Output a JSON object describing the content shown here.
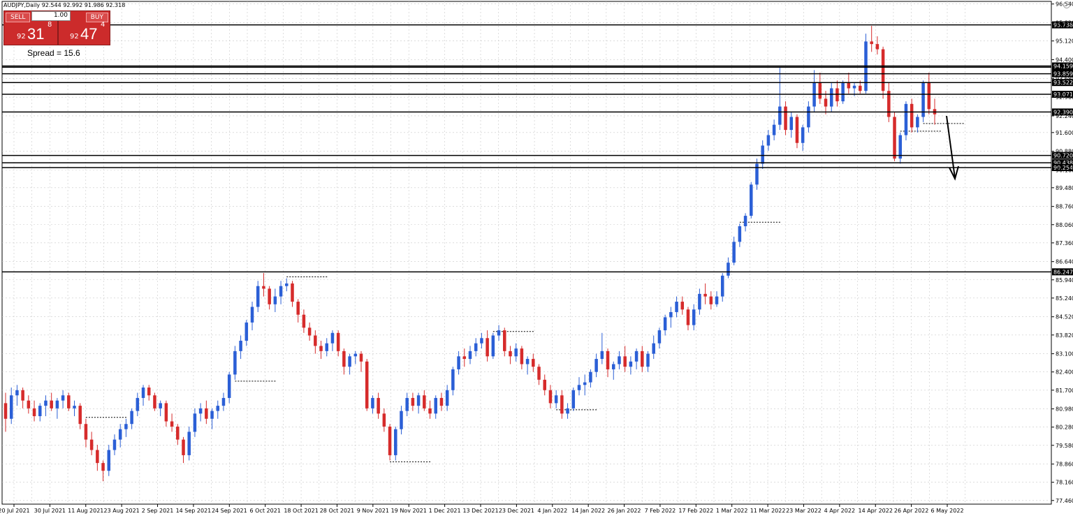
{
  "header": {
    "symbol_line": "AUDJPY,Daily  92.544 92.992 91.986 92.318"
  },
  "trade_panel": {
    "sell_label": "SELL",
    "buy_label": "BUY",
    "quantity": "1.00",
    "sell_price": {
      "prefix": "92",
      "big": "31",
      "sup": "8"
    },
    "buy_price": {
      "prefix": "92",
      "big": "47",
      "sup": "4"
    },
    "spread_text": "Spread = 15.6"
  },
  "colors": {
    "bull": "#2b5fd6",
    "bear": "#d62b2b",
    "grid": "#c8c8c8",
    "level": "#000000"
  },
  "chart_data": {
    "type": "candlestick",
    "symbol": "AUDJPY",
    "timeframe": "Daily",
    "ylim": [
      77.32,
      96.64
    ],
    "y_ticks": [
      "96.540",
      "95.820",
      "95.120",
      "94.400",
      "93.680",
      "92.960",
      "92.240",
      "91.600",
      "90.880",
      "90.160",
      "89.480",
      "88.760",
      "88.060",
      "87.360",
      "86.640",
      "85.940",
      "85.240",
      "84.520",
      "83.820",
      "83.100",
      "82.400",
      "81.700",
      "80.980",
      "80.280",
      "79.580",
      "78.860",
      "78.160",
      "77.460"
    ],
    "x_ticks": [
      "20 Jul 2021",
      "30 Jul 2021",
      "11 Aug 2021",
      "23 Aug 2021",
      "2 Sep 2021",
      "14 Sep 2021",
      "24 Sep 2021",
      "6 Oct 2021",
      "18 Oct 2021",
      "28 Oct 2021",
      "9 Nov 2021",
      "19 Nov 2021",
      "1 Dec 2021",
      "13 Dec 2021",
      "23 Dec 2021",
      "4 Jan 2022",
      "14 Jan 2022",
      "26 Jan 2022",
      "7 Feb 2022",
      "17 Feb 2022",
      "1 Mar 2022",
      "11 Mar 2022",
      "23 Mar 2022",
      "4 Apr 2022",
      "14 Apr 2022",
      "26 Apr 2022",
      "6 May 2022"
    ],
    "levels": [
      {
        "value": 95.738,
        "label": "95.738"
      },
      {
        "value": 94.111,
        "label": "94.111"
      },
      {
        "value": 94.159,
        "label": "94.159"
      },
      {
        "value": 93.859,
        "label": "93.859"
      },
      {
        "value": 93.522,
        "label": "93.522"
      },
      {
        "value": 93.071,
        "label": "93.071"
      },
      {
        "value": 92.39,
        "label": "92.390"
      },
      {
        "value": 90.72,
        "label": "90.720"
      },
      {
        "value": 90.438,
        "label": "90.438"
      },
      {
        "value": 90.254,
        "label": "90.254"
      },
      {
        "value": 86.247,
        "label": "86.247"
      }
    ],
    "candles": [
      [
        81.2,
        81.6,
        80.1,
        80.6
      ],
      [
        80.6,
        81.8,
        80.4,
        81.5
      ],
      [
        81.5,
        81.9,
        81.1,
        81.7
      ],
      [
        81.7,
        81.8,
        81.0,
        81.3
      ],
      [
        81.3,
        81.5,
        80.8,
        81.0
      ],
      [
        81.0,
        81.3,
        80.5,
        80.7
      ],
      [
        80.7,
        81.2,
        80.5,
        81.1
      ],
      [
        81.1,
        81.5,
        80.7,
        81.3
      ],
      [
        81.3,
        81.6,
        80.9,
        81.0
      ],
      [
        81.0,
        81.4,
        80.6,
        81.3
      ],
      [
        81.3,
        81.7,
        81.0,
        81.5
      ],
      [
        81.5,
        81.6,
        80.9,
        81.0
      ],
      [
        81.0,
        81.3,
        80.7,
        81.1
      ],
      [
        81.1,
        81.2,
        80.2,
        80.4
      ],
      [
        80.4,
        80.6,
        79.5,
        79.8
      ],
      [
        79.8,
        80.1,
        79.2,
        79.4
      ],
      [
        79.4,
        79.6,
        78.6,
        78.9
      ],
      [
        78.9,
        79.0,
        78.2,
        78.6
      ],
      [
        78.6,
        79.6,
        78.4,
        79.4
      ],
      [
        79.4,
        80.0,
        79.2,
        79.8
      ],
      [
        79.8,
        80.4,
        79.5,
        80.2
      ],
      [
        80.2,
        80.6,
        79.9,
        80.4
      ],
      [
        80.4,
        81.0,
        80.2,
        80.9
      ],
      [
        80.9,
        81.6,
        80.7,
        81.4
      ],
      [
        81.4,
        81.9,
        81.1,
        81.8
      ],
      [
        81.8,
        81.9,
        81.3,
        81.5
      ],
      [
        81.5,
        81.6,
        80.9,
        81.0
      ],
      [
        81.0,
        81.3,
        80.7,
        81.2
      ],
      [
        81.2,
        81.3,
        80.3,
        80.5
      ],
      [
        80.5,
        80.8,
        80.1,
        80.3
      ],
      [
        80.3,
        80.4,
        79.6,
        79.8
      ],
      [
        79.8,
        79.9,
        78.9,
        79.2
      ],
      [
        79.2,
        80.3,
        79.0,
        80.1
      ],
      [
        80.1,
        81.0,
        79.9,
        80.8
      ],
      [
        80.8,
        81.2,
        80.5,
        81.0
      ],
      [
        81.0,
        81.3,
        80.4,
        80.6
      ],
      [
        80.6,
        81.0,
        80.2,
        80.9
      ],
      [
        80.9,
        81.3,
        80.6,
        81.1
      ],
      [
        81.1,
        81.6,
        80.9,
        81.4
      ],
      [
        81.4,
        82.4,
        81.2,
        82.3
      ],
      [
        82.3,
        83.4,
        82.1,
        83.2
      ],
      [
        83.2,
        83.8,
        82.9,
        83.6
      ],
      [
        83.6,
        84.4,
        83.4,
        84.3
      ],
      [
        84.3,
        85.1,
        84.0,
        84.9
      ],
      [
        84.9,
        85.9,
        84.7,
        85.7
      ],
      [
        85.7,
        86.2,
        85.3,
        85.6
      ],
      [
        85.6,
        85.7,
        84.8,
        85.0
      ],
      [
        85.0,
        85.6,
        84.7,
        85.3
      ],
      [
        85.3,
        85.9,
        85.0,
        85.7
      ],
      [
        85.7,
        86.0,
        85.5,
        85.8
      ],
      [
        85.8,
        85.9,
        84.9,
        85.1
      ],
      [
        85.1,
        85.2,
        84.3,
        84.6
      ],
      [
        84.6,
        84.8,
        83.9,
        84.1
      ],
      [
        84.1,
        84.3,
        83.6,
        83.8
      ],
      [
        83.8,
        84.0,
        83.1,
        83.4
      ],
      [
        83.4,
        83.6,
        82.9,
        83.2
      ],
      [
        83.2,
        83.7,
        83.0,
        83.5
      ],
      [
        83.5,
        84.0,
        83.2,
        83.9
      ],
      [
        83.9,
        84.0,
        83.0,
        83.2
      ],
      [
        83.2,
        83.3,
        82.3,
        82.6
      ],
      [
        82.6,
        83.1,
        82.3,
        83.0
      ],
      [
        83.0,
        83.2,
        82.7,
        83.1
      ],
      [
        83.1,
        83.2,
        82.4,
        82.8
      ],
      [
        82.8,
        82.9,
        80.9,
        81.0
      ],
      [
        81.0,
        81.5,
        80.8,
        81.4
      ],
      [
        81.4,
        81.6,
        80.6,
        80.8
      ],
      [
        80.8,
        81.0,
        80.1,
        80.3
      ],
      [
        80.3,
        80.4,
        79.0,
        79.2
      ],
      [
        79.2,
        80.3,
        79.0,
        80.2
      ],
      [
        80.2,
        81.1,
        80.0,
        80.9
      ],
      [
        80.9,
        81.6,
        80.7,
        81.4
      ],
      [
        81.4,
        81.6,
        80.9,
        81.1
      ],
      [
        81.1,
        81.6,
        80.8,
        81.5
      ],
      [
        81.5,
        81.7,
        80.9,
        81.0
      ],
      [
        81.0,
        81.3,
        80.6,
        80.8
      ],
      [
        80.8,
        81.5,
        80.6,
        81.4
      ],
      [
        81.4,
        81.6,
        80.9,
        81.1
      ],
      [
        81.1,
        81.9,
        80.9,
        81.7
      ],
      [
        81.7,
        82.6,
        81.5,
        82.5
      ],
      [
        82.5,
        83.2,
        82.3,
        83.0
      ],
      [
        83.0,
        83.3,
        82.6,
        82.9
      ],
      [
        82.9,
        83.4,
        82.7,
        83.2
      ],
      [
        83.2,
        83.7,
        83.0,
        83.5
      ],
      [
        83.5,
        83.9,
        83.3,
        83.7
      ],
      [
        83.7,
        84.0,
        82.8,
        83.0
      ],
      [
        83.0,
        83.9,
        82.9,
        83.8
      ],
      [
        83.8,
        84.2,
        83.6,
        84.0
      ],
      [
        84.0,
        84.1,
        83.0,
        83.2
      ],
      [
        83.2,
        83.4,
        82.7,
        83.0
      ],
      [
        83.0,
        83.5,
        82.8,
        83.3
      ],
      [
        83.3,
        83.4,
        82.5,
        82.7
      ],
      [
        82.7,
        83.0,
        82.3,
        82.9
      ],
      [
        82.9,
        83.1,
        82.4,
        82.6
      ],
      [
        82.6,
        82.7,
        81.9,
        82.1
      ],
      [
        82.1,
        82.3,
        81.5,
        81.7
      ],
      [
        81.7,
        81.9,
        81.0,
        81.2
      ],
      [
        81.2,
        81.7,
        81.0,
        81.5
      ],
      [
        81.5,
        81.7,
        80.6,
        80.8
      ],
      [
        80.8,
        81.2,
        80.6,
        81.0
      ],
      [
        81.0,
        81.8,
        80.9,
        81.7
      ],
      [
        81.7,
        82.2,
        81.5,
        81.9
      ],
      [
        81.9,
        82.3,
        81.5,
        82.0
      ],
      [
        82.0,
        82.5,
        81.8,
        82.4
      ],
      [
        82.4,
        83.1,
        82.2,
        82.9
      ],
      [
        82.9,
        83.9,
        82.7,
        83.2
      ],
      [
        83.2,
        83.3,
        82.2,
        82.5
      ],
      [
        82.5,
        82.8,
        82.1,
        82.7
      ],
      [
        82.7,
        83.2,
        82.5,
        83.0
      ],
      [
        83.0,
        83.4,
        82.4,
        82.6
      ],
      [
        82.6,
        83.0,
        82.3,
        82.8
      ],
      [
        82.8,
        83.3,
        82.5,
        83.2
      ],
      [
        83.2,
        83.4,
        82.4,
        82.6
      ],
      [
        82.6,
        83.2,
        82.4,
        83.1
      ],
      [
        83.1,
        83.8,
        82.9,
        83.5
      ],
      [
        83.5,
        84.1,
        83.3,
        84.0
      ],
      [
        84.0,
        84.6,
        83.8,
        84.5
      ],
      [
        84.5,
        84.9,
        84.1,
        84.7
      ],
      [
        84.7,
        85.3,
        84.5,
        85.1
      ],
      [
        85.1,
        85.3,
        84.6,
        84.8
      ],
      [
        84.8,
        84.9,
        84.0,
        84.2
      ],
      [
        84.2,
        85.0,
        84.0,
        84.8
      ],
      [
        84.8,
        85.6,
        84.6,
        85.4
      ],
      [
        85.4,
        85.8,
        85.0,
        85.3
      ],
      [
        85.3,
        85.5,
        84.8,
        85.0
      ],
      [
        85.0,
        85.5,
        84.9,
        85.3
      ],
      [
        85.3,
        86.2,
        85.1,
        86.1
      ],
      [
        86.1,
        86.8,
        86.0,
        86.6
      ],
      [
        86.6,
        87.6,
        86.5,
        87.4
      ],
      [
        87.4,
        88.1,
        87.2,
        88.0
      ],
      [
        88.0,
        88.5,
        87.8,
        88.4
      ],
      [
        88.4,
        89.7,
        88.3,
        89.6
      ],
      [
        89.6,
        90.6,
        89.4,
        90.4
      ],
      [
        90.4,
        91.3,
        90.2,
        91.1
      ],
      [
        91.1,
        91.7,
        90.9,
        91.5
      ],
      [
        91.5,
        92.1,
        91.3,
        91.9
      ],
      [
        91.9,
        94.1,
        91.7,
        92.6
      ],
      [
        92.6,
        92.8,
        91.5,
        91.7
      ],
      [
        91.7,
        92.4,
        91.4,
        92.2
      ],
      [
        92.2,
        92.3,
        91.0,
        91.2
      ],
      [
        91.2,
        91.9,
        90.9,
        91.8
      ],
      [
        91.8,
        92.8,
        91.6,
        92.6
      ],
      [
        92.6,
        94.0,
        92.4,
        93.5
      ],
      [
        93.5,
        93.9,
        92.7,
        92.9
      ],
      [
        92.9,
        93.2,
        92.3,
        92.6
      ],
      [
        92.6,
        93.5,
        92.4,
        93.3
      ],
      [
        93.3,
        93.6,
        92.6,
        92.8
      ],
      [
        92.8,
        93.6,
        92.7,
        93.5
      ],
      [
        93.5,
        93.9,
        93.1,
        93.3
      ],
      [
        93.3,
        93.5,
        93.0,
        93.4
      ],
      [
        93.4,
        93.6,
        93.1,
        93.2
      ],
      [
        93.2,
        95.4,
        93.1,
        95.1
      ],
      [
        95.1,
        95.7,
        94.7,
        95.0
      ],
      [
        95.0,
        95.3,
        94.6,
        94.8
      ],
      [
        94.8,
        94.9,
        92.9,
        93.2
      ],
      [
        93.2,
        93.5,
        92.0,
        92.2
      ],
      [
        92.2,
        92.4,
        90.5,
        90.6
      ],
      [
        90.6,
        91.6,
        90.4,
        91.5
      ],
      [
        91.5,
        92.8,
        91.3,
        92.7
      ],
      [
        92.7,
        92.9,
        91.6,
        91.8
      ],
      [
        91.8,
        92.3,
        91.6,
        92.2
      ],
      [
        92.2,
        93.6,
        92.0,
        93.5
      ],
      [
        93.5,
        93.9,
        92.3,
        92.5
      ],
      [
        92.5,
        92.9,
        91.9,
        92.3
      ]
    ]
  }
}
